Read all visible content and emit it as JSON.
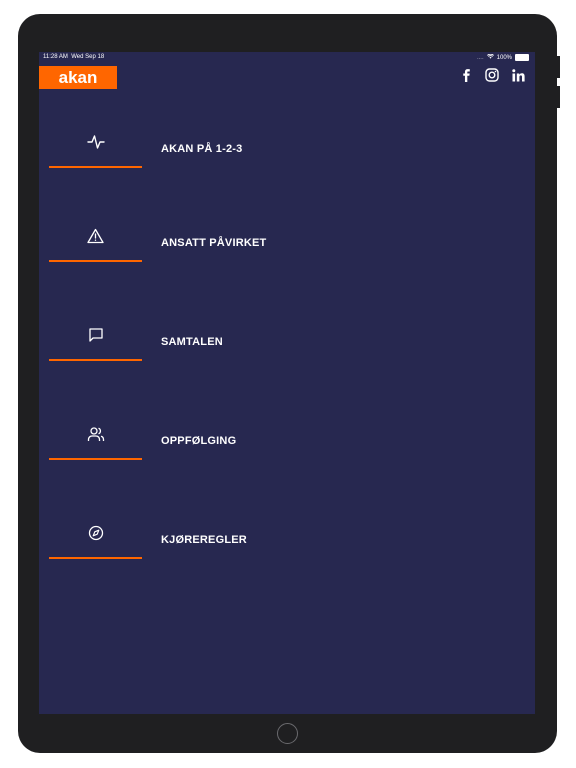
{
  "colors": {
    "background": "#272850",
    "accent": "#ff6600",
    "text": "#ffffff",
    "device": "#1f1f21"
  },
  "status_bar": {
    "time": "11:28 AM",
    "date": "Wed Sep 18",
    "signal": "....",
    "battery": "100%"
  },
  "header": {
    "logo_text": "akan",
    "social": [
      {
        "icon": "facebook-icon"
      },
      {
        "icon": "instagram-icon"
      },
      {
        "icon": "linkedin-icon"
      }
    ]
  },
  "menu": {
    "items": [
      {
        "icon": "pulse-icon",
        "label": "AKAN PÅ 1-2-3"
      },
      {
        "icon": "warning-triangle-icon",
        "label": "ANSATT PÅVIRKET"
      },
      {
        "icon": "chat-bubble-icon",
        "label": "SAMTALEN"
      },
      {
        "icon": "users-icon",
        "label": "OPPFØLGING"
      },
      {
        "icon": "compass-icon",
        "label": "KJØREREGLER"
      }
    ]
  }
}
